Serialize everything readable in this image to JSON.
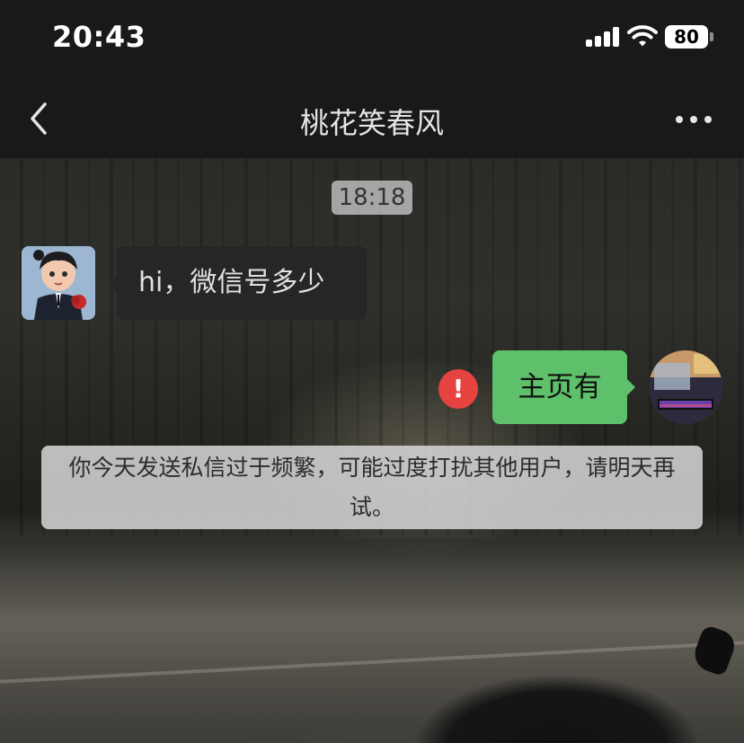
{
  "status_bar": {
    "time": "20:43",
    "battery_level": "80",
    "signal_icon": "cellular-signal-icon",
    "wifi_icon": "wifi-icon"
  },
  "nav": {
    "back_icon": "chevron-left-icon",
    "title": "桃花笑春风",
    "more_icon": "more-horizontal-icon"
  },
  "chat": {
    "timestamp": "18:18",
    "messages": [
      {
        "side": "left",
        "text": "hi，微信号多少",
        "bubble_color": "#262626"
      },
      {
        "side": "right",
        "text": "主页有",
        "bubble_color": "#5ec06b",
        "send_failed": true
      }
    ],
    "error_icon_text": "!",
    "system_notice": "你今天发送私信过于频繁，可能过度打扰其他用户，请明天再试。"
  },
  "colors": {
    "bar_background": "#191919",
    "error_red": "#e64340",
    "sent_bubble_green": "#5ec06b"
  }
}
